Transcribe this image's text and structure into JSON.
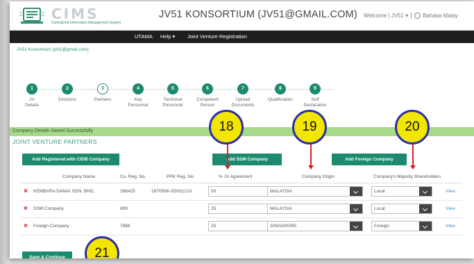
{
  "header": {
    "logo_word": "CIMS",
    "logo_tagline": "Centralized Information Management System",
    "title": "JV51 KONSORTIUM (JV51@GMAIL.COM)",
    "welcome": "Welcome | JV51 ▾",
    "language": "Bahasa Malay"
  },
  "nav": {
    "utama": "UTAMA",
    "help": "Help ▾",
    "jv_registration": "Joint Venture Registration"
  },
  "user_line": "JV51 Konsortium (jv51@gmail.com)",
  "steps": [
    {
      "num": "1",
      "label": "JV\nDetails",
      "state": "done"
    },
    {
      "num": "2",
      "label": "Directors",
      "state": "done"
    },
    {
      "num": "3",
      "label": "Partners",
      "state": "current"
    },
    {
      "num": "4",
      "label": "Key\nPersonnel",
      "state": "done"
    },
    {
      "num": "5",
      "label": "Technical\nPersonnel",
      "state": "done"
    },
    {
      "num": "6",
      "label": "Competent\nPerson",
      "state": "done"
    },
    {
      "num": "7",
      "label": "Upload\nDocuments",
      "state": "done"
    },
    {
      "num": "8",
      "label": "Qualification",
      "state": "done"
    },
    {
      "num": "9",
      "label": "Self\nDeclaration",
      "state": "done"
    }
  ],
  "success_message": "Company Details Saved Successfully",
  "section_title": "JOINT VENTURE PARTNERS",
  "buttons": {
    "add_cidb": "Add Registered with CIDB Company",
    "add_ssm": "Add SSM Company",
    "add_foreign": "Add Foreign Company",
    "save_continue": "Save & Continue"
  },
  "table": {
    "headers": [
      "Company Name",
      "Co. Reg. No.",
      "PPK Reg. No.",
      "% JV Agreement",
      "Company Origin",
      "Company's Majority Shareholders"
    ],
    "rows": [
      {
        "name": "KEMBARA DAMAI SDN. BHD.",
        "co_reg": "286425",
        "ppk_reg": "1970508-XD031210",
        "jv": "50",
        "origin": "MALAYSIA",
        "shareholders": "Local",
        "view": "View"
      },
      {
        "name": "SSM Company",
        "co_reg": "899",
        "ppk_reg": "",
        "jv": "25",
        "origin": "MALAYSIA",
        "shareholders": "Local",
        "view": "View"
      },
      {
        "name": "Foreign Company",
        "co_reg": "7888",
        "ppk_reg": "",
        "jv": "25",
        "origin": "SINGAPORE",
        "shareholders": "Foreign",
        "view": "View"
      }
    ]
  },
  "callouts": [
    "18",
    "19",
    "20",
    "21"
  ],
  "colors": {
    "accent_green": "#1c8a6e",
    "success_bg": "#a7d98a",
    "navbar": "#1e1e1e",
    "callout_fill": "#f3e600",
    "callout_border": "#2a2fa8",
    "arrow_red": "#d52020",
    "delete_red": "#c21a1a"
  }
}
